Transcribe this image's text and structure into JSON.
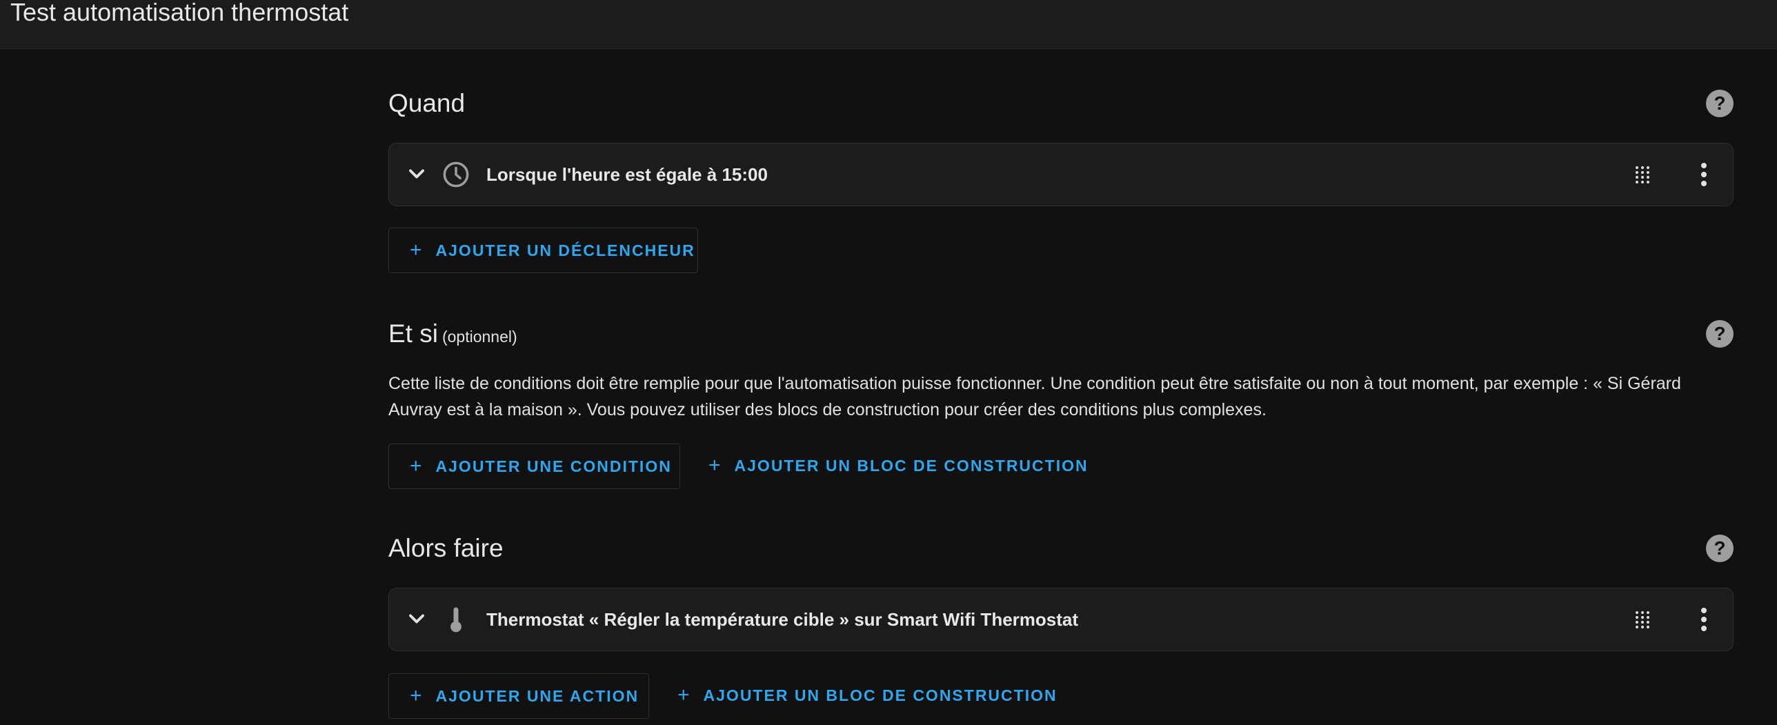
{
  "window": {
    "title": "Test automatisation thermostat"
  },
  "sections": {
    "when": {
      "title": "Quand",
      "help_icon": "help-circle-icon",
      "trigger": {
        "icon": "clock-icon",
        "label": "Lorsque l'heure est égale à 15:00"
      },
      "add_button": "AJOUTER UN DÉCLENCHEUR"
    },
    "and_if": {
      "title": "Et si",
      "optional": "(optionnel)",
      "help_icon": "help-circle-icon",
      "description": "Cette liste de conditions doit être remplie pour que l'automatisation puisse fonctionner. Une condition peut être satisfaite ou non à tout moment, par exemple : « Si Gérard Auvray est à la maison ». Vous pouvez utiliser des blocs de construction pour créer des conditions plus complexes.",
      "add_condition": "AJOUTER UNE CONDITION",
      "add_block": "AJOUTER UN BLOC DE CONSTRUCTION"
    },
    "then_do": {
      "title": "Alors faire",
      "help_icon": "help-circle-icon",
      "action": {
        "icon": "thermometer-icon",
        "label": "Thermostat « Régler la température cible » sur Smart Wifi Thermostat"
      },
      "add_action": "AJOUTER UNE ACTION",
      "add_block": "AJOUTER UN BLOC DE CONSTRUCTION"
    }
  },
  "colors": {
    "background": "#111111",
    "card": "#1c1c1c",
    "accent": "#2ea7ef",
    "icon": "#9e9e9e"
  }
}
